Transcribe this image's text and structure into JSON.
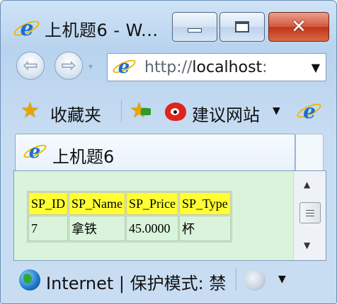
{
  "window": {
    "title": "上机题6 - W..."
  },
  "titlebar": {
    "minimize_icon": "minimize-icon",
    "maximize_icon": "maximize-icon",
    "close_glyph": "✕"
  },
  "navigation": {
    "back_glyph": "⇦",
    "forward_glyph": "⇨",
    "dropdown_glyph": "▾",
    "address_prefix": "http://",
    "address_host": "localhost",
    "address_rest": ":",
    "address_dropdown_glyph": "▼"
  },
  "favorites_bar": {
    "favorites_label": "收藏夹",
    "suggested_sites_label": "建议网站",
    "suggested_dropdown_glyph": "▼"
  },
  "tabs": [
    {
      "label": "上机题6"
    }
  ],
  "table": {
    "headers": [
      "SP_ID",
      "SP_Name",
      "SP_Price",
      "SP_Type"
    ],
    "rows": [
      [
        "7",
        "拿铁",
        "45.0000",
        "杯"
      ]
    ],
    "header_color": "#ffff33",
    "background_color": "#d9f4da"
  },
  "scrollbar": {
    "up_glyph": "▲",
    "down_glyph": "▼"
  },
  "status_bar": {
    "zone_text": "Internet | 保护模式: 禁",
    "dropdown_glyph": "▼"
  }
}
